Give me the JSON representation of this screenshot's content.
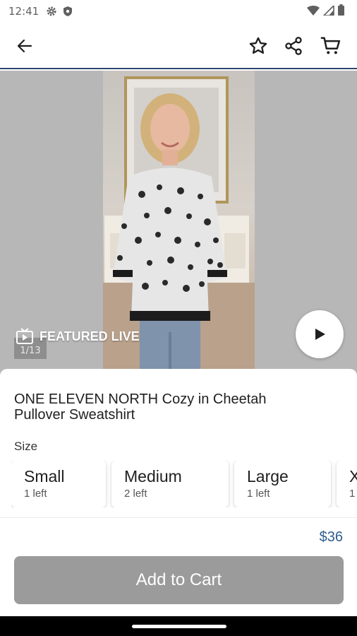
{
  "status_bar": {
    "time": "12:41",
    "left_icons": [
      "settings-icon",
      "shield-icon"
    ],
    "right_icons": [
      "wifi-icon",
      "signal-icon",
      "battery-icon"
    ]
  },
  "app_bar": {
    "icons": [
      "back-arrow-icon",
      "star-icon",
      "share-icon",
      "cart-icon"
    ]
  },
  "media": {
    "featured_label": "FEATURED LIVE",
    "counter": "1/13",
    "icons": [
      "tv-icon",
      "play-icon"
    ]
  },
  "product": {
    "title": "ONE ELEVEN NORTH Cozy in Cheetah Pullover Sweatshirt",
    "size_label": "Size",
    "sizes": [
      {
        "name": "Small",
        "stock": "1 left"
      },
      {
        "name": "Medium",
        "stock": "2 left"
      },
      {
        "name": "Large",
        "stock": "1 left"
      },
      {
        "name": "X",
        "stock": "1"
      }
    ],
    "price": "$36",
    "add_button": "Add to Cart"
  },
  "colors": {
    "accent": "#2f5d91",
    "app_bar_border": "#2e4a6e",
    "button_disabled": "#9b9b9b",
    "media_bg": "#b7b7b8"
  }
}
